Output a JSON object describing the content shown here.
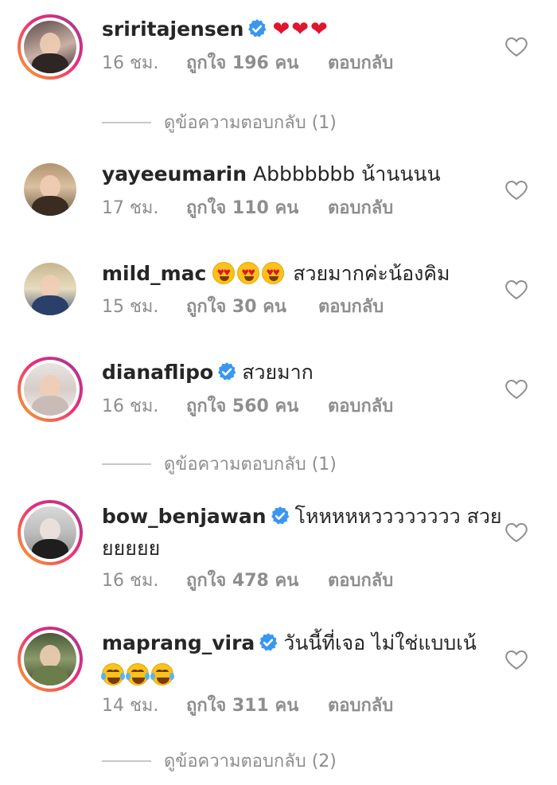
{
  "comments": [
    {
      "username": "sriritajensen",
      "verified": true,
      "text": "❤❤❤",
      "text_type": "hearts",
      "time": "16 ชม.",
      "likes": "ถูกใจ 196 คน",
      "reply": "ตอบกลับ",
      "view_replies": "ดูข้อความตอบกลับ (1)"
    },
    {
      "username": "yayeeumarin",
      "verified": false,
      "text": "Abbbbbbb น้านนนน",
      "time": "17 ชม.",
      "likes": "ถูกใจ 110 คน",
      "reply": "ตอบกลับ"
    },
    {
      "username": "mild_mac",
      "verified": false,
      "emoji": "heart-eyes-face x3",
      "text": "สวยมากค่ะน้องคิม",
      "time": "15 ชม.",
      "likes": "ถูกใจ 30 คน",
      "reply": "ตอบกลับ"
    },
    {
      "username": "dianaflipo",
      "verified": true,
      "text": "สวยมาก",
      "time": "16 ชม.",
      "likes": "ถูกใจ 560 คน",
      "reply": "ตอบกลับ",
      "view_replies": "ดูข้อความตอบกลับ (1)"
    },
    {
      "username": "bow_benjawan",
      "verified": true,
      "text": "โหหหหหวววววววว สวย",
      "text_cont": "ยยยยย",
      "time": "16 ชม.",
      "likes": "ถูกใจ 478 คน",
      "reply": "ตอบกลับ"
    },
    {
      "username": "maprang_vira",
      "verified": true,
      "text": "วันนี้ที่เจอ ไม่ใช่แบบเน้",
      "emoji_cont": "laughing-tears-face x3",
      "time": "14 ชม.",
      "likes": "ถูกใจ 311 คน",
      "reply": "ตอบกลับ",
      "view_replies": "ดูข้อความตอบกลับ (2)"
    }
  ],
  "colors": {
    "text": "#262626",
    "secondary": "#8e8e8e",
    "verified": "#3897f0",
    "heart_red": "#e0152e",
    "story_ring_start": "#f9a825",
    "story_ring_end": "#c13584"
  },
  "icons": {
    "verified": "verified-badge-icon",
    "like": "heart-outline-icon"
  }
}
